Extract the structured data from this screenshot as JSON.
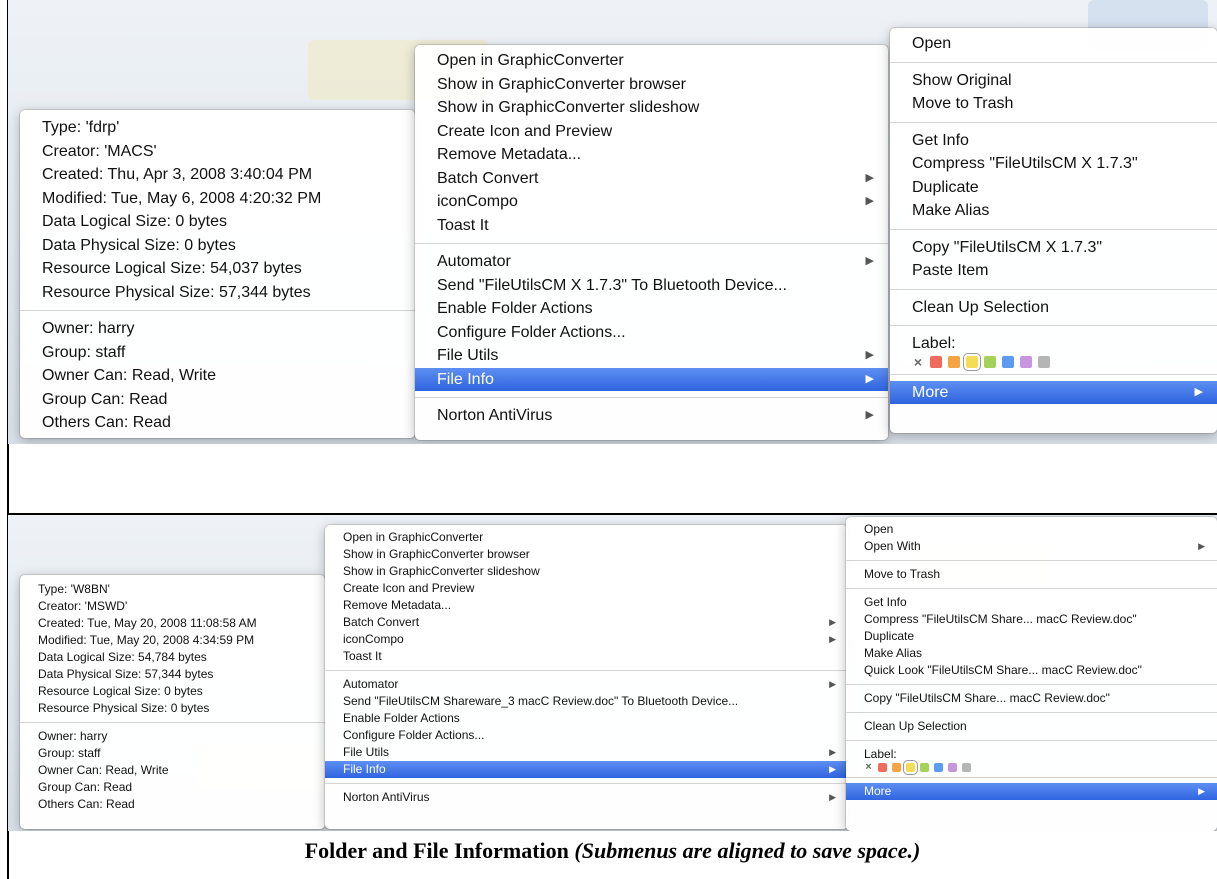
{
  "top": {
    "info_groups": [
      [
        "Type: 'fdrp'",
        "Creator: 'MACS'",
        "Created: Thu, Apr 3, 2008 3:40:04 PM",
        "Modified: Tue, May 6, 2008 4:20:32 PM",
        "Data Logical Size: 0 bytes",
        "Data Physical Size: 0 bytes",
        "Resource Logical Size: 54,037 bytes",
        "Resource Physical Size: 57,344 bytes"
      ],
      [
        "Owner: harry",
        "Group: staff",
        "Owner Can: Read, Write",
        "Group Can: Read",
        "Others Can: Read"
      ]
    ],
    "context_groups": [
      [
        {
          "label": "Open in GraphicConverter"
        },
        {
          "label": "Show in GraphicConverter browser"
        },
        {
          "label": "Show in GraphicConverter slideshow"
        },
        {
          "label": "Create Icon and Preview"
        },
        {
          "label": "Remove Metadata..."
        },
        {
          "label": "Batch Convert",
          "submenu": true
        },
        {
          "label": "iconCompo",
          "submenu": true
        },
        {
          "label": "Toast It"
        }
      ],
      [
        {
          "label": "Automator",
          "submenu": true
        },
        {
          "label": "Send \"FileUtilsCM X 1.7.3\" To Bluetooth Device..."
        },
        {
          "label": "Enable Folder Actions"
        },
        {
          "label": "Configure Folder Actions..."
        },
        {
          "label": "File Utils",
          "submenu": true
        },
        {
          "label": "File Info",
          "submenu": true,
          "selected": true
        }
      ],
      [
        {
          "label": "Norton AntiVirus",
          "submenu": true
        }
      ]
    ],
    "finder_groups": [
      [
        {
          "label": "Open"
        }
      ],
      [
        {
          "label": "Show Original"
        },
        {
          "label": "Move to Trash"
        }
      ],
      [
        {
          "label": "Get Info"
        },
        {
          "label": "Compress \"FileUtilsCM X 1.7.3\""
        },
        {
          "label": "Duplicate"
        },
        {
          "label": "Make Alias"
        }
      ],
      [
        {
          "label": "Copy \"FileUtilsCM X 1.7.3\""
        },
        {
          "label": "Paste Item"
        }
      ],
      [
        {
          "label": "Clean Up Selection"
        }
      ]
    ],
    "label_title": "Label:",
    "more": {
      "label": "More",
      "submenu": true,
      "selected": true
    }
  },
  "bottom": {
    "info_groups": [
      [
        "Type: 'W8BN'",
        "Creator: 'MSWD'",
        "Created: Tue, May 20, 2008 11:08:58 AM",
        "Modified: Tue, May 20, 2008 4:34:59 PM",
        "Data Logical Size: 54,784 bytes",
        "Data Physical Size: 57,344 bytes",
        "Resource Logical Size: 0 bytes",
        "Resource Physical Size: 0 bytes"
      ],
      [
        "Owner: harry",
        "Group: staff",
        "Owner Can: Read, Write",
        "Group Can: Read",
        "Others Can: Read"
      ]
    ],
    "context_groups": [
      [
        {
          "label": "Open in GraphicConverter"
        },
        {
          "label": "Show in GraphicConverter browser"
        },
        {
          "label": "Show in GraphicConverter slideshow"
        },
        {
          "label": "Create Icon and Preview"
        },
        {
          "label": "Remove Metadata..."
        },
        {
          "label": "Batch Convert",
          "submenu": true
        },
        {
          "label": "iconCompo",
          "submenu": true
        },
        {
          "label": "Toast It"
        }
      ],
      [
        {
          "label": "Automator",
          "submenu": true
        },
        {
          "label": "Send \"FileUtilsCM Shareware_3 macC Review.doc\" To Bluetooth Device..."
        },
        {
          "label": "Enable Folder Actions"
        },
        {
          "label": "Configure Folder Actions..."
        },
        {
          "label": "File Utils",
          "submenu": true
        },
        {
          "label": "File Info",
          "submenu": true,
          "selected": true
        }
      ],
      [
        {
          "label": "Norton AntiVirus",
          "submenu": true
        }
      ]
    ],
    "finder_groups": [
      [
        {
          "label": "Open"
        },
        {
          "label": "Open With",
          "submenu": true
        }
      ],
      [
        {
          "label": "Move to Trash"
        }
      ],
      [
        {
          "label": "Get Info"
        },
        {
          "label": "Compress \"FileUtilsCM Share... macC Review.doc\""
        },
        {
          "label": "Duplicate"
        },
        {
          "label": "Make Alias"
        },
        {
          "label": "Quick Look \"FileUtilsCM Share... macC Review.doc\""
        }
      ],
      [
        {
          "label": "Copy \"FileUtilsCM Share... macC Review.doc\""
        }
      ],
      [
        {
          "label": "Clean Up Selection"
        }
      ]
    ],
    "label_title": "Label:",
    "more": {
      "label": "More",
      "submenu": true,
      "selected": true
    }
  },
  "label_colors": [
    {
      "name": "none",
      "color": "",
      "glyph": "×"
    },
    {
      "name": "red",
      "color": "#ef6b5d"
    },
    {
      "name": "orange",
      "color": "#f5a443"
    },
    {
      "name": "yellow",
      "color": "#f4dd56",
      "selected": true
    },
    {
      "name": "green",
      "color": "#a5d35a"
    },
    {
      "name": "blue",
      "color": "#5b9cf1"
    },
    {
      "name": "purple",
      "color": "#c896e0"
    },
    {
      "name": "gray",
      "color": "#b5b5b5"
    }
  ],
  "arrow_glyph": "▶",
  "caption": {
    "title": "Folder and File Information ",
    "note": "(Submenus are aligned to save space.)"
  },
  "colors": {
    "selection": "#3a6fe5",
    "frame": "#000000"
  }
}
